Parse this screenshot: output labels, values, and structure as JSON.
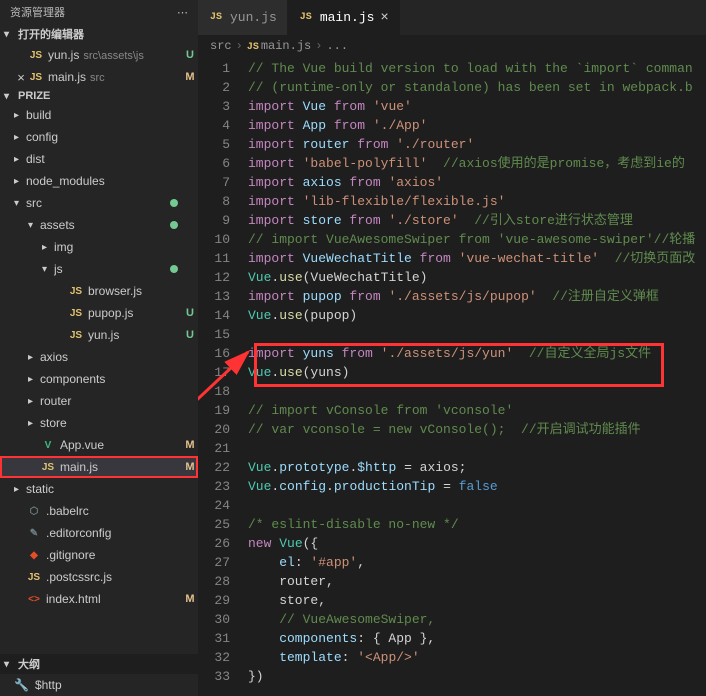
{
  "sidebar": {
    "title": "资源管理器",
    "open_editors_label": "打开的编辑器",
    "project_label": "PRIZE",
    "outline_label": "大纲",
    "open_editors": [
      {
        "icon": "JS",
        "name": "yun.js",
        "path": "src\\assets\\js",
        "status": "U"
      },
      {
        "icon": "JS",
        "name": "main.js",
        "path": "src",
        "status": "M",
        "close": true
      }
    ],
    "tree": [
      {
        "type": "folder",
        "name": "build",
        "indent": 0,
        "expanded": false
      },
      {
        "type": "folder",
        "name": "config",
        "indent": 0,
        "expanded": false
      },
      {
        "type": "folder",
        "name": "dist",
        "indent": 0,
        "expanded": false
      },
      {
        "type": "folder",
        "name": "node_modules",
        "indent": 0,
        "expanded": false
      },
      {
        "type": "folder",
        "name": "src",
        "indent": 0,
        "expanded": true,
        "dot": true
      },
      {
        "type": "folder",
        "name": "assets",
        "indent": 1,
        "expanded": true,
        "dot": true
      },
      {
        "type": "folder",
        "name": "img",
        "indent": 2,
        "expanded": false
      },
      {
        "type": "folder",
        "name": "js",
        "indent": 2,
        "expanded": true,
        "dot": true
      },
      {
        "type": "file",
        "icon": "JS",
        "name": "browser.js",
        "indent": 3
      },
      {
        "type": "file",
        "icon": "JS",
        "name": "pupop.js",
        "indent": 3,
        "status": "U"
      },
      {
        "type": "file",
        "icon": "JS",
        "name": "yun.js",
        "indent": 3,
        "status": "U"
      },
      {
        "type": "folder",
        "name": "axios",
        "indent": 1,
        "expanded": false
      },
      {
        "type": "folder",
        "name": "components",
        "indent": 1,
        "expanded": false
      },
      {
        "type": "folder",
        "name": "router",
        "indent": 1,
        "expanded": false
      },
      {
        "type": "folder",
        "name": "store",
        "indent": 1,
        "expanded": false
      },
      {
        "type": "file",
        "icon": "V",
        "iconClass": "icon-vue",
        "name": "App.vue",
        "indent": 1,
        "status": "M"
      },
      {
        "type": "file",
        "icon": "JS",
        "name": "main.js",
        "indent": 1,
        "status": "M",
        "highlighted": true,
        "selected": true
      },
      {
        "type": "folder",
        "name": "static",
        "indent": 0,
        "expanded": false
      },
      {
        "type": "file",
        "icon": "⬡",
        "iconClass": "icon-conf",
        "name": ".babelrc",
        "indent": 0
      },
      {
        "type": "file",
        "icon": "✎",
        "iconClass": "icon-conf",
        "name": ".editorconfig",
        "indent": 0
      },
      {
        "type": "file",
        "icon": "◆",
        "iconClass": "icon-git",
        "name": ".gitignore",
        "indent": 0
      },
      {
        "type": "file",
        "icon": "JS",
        "name": ".postcssrc.js",
        "indent": 0
      },
      {
        "type": "file",
        "icon": "<>",
        "iconClass": "icon-html",
        "name": "index.html",
        "indent": 0,
        "status": "M"
      }
    ],
    "outline_item": "$http"
  },
  "tabs": [
    {
      "icon": "JS",
      "name": "yun.js",
      "active": false
    },
    {
      "icon": "JS",
      "name": "main.js",
      "active": true
    }
  ],
  "breadcrumb": [
    "src",
    "main.js",
    "..."
  ],
  "code": {
    "lines": [
      [
        {
          "t": "// The Vue build version to load with the `import` comman",
          "c": "c-comment"
        }
      ],
      [
        {
          "t": "// (runtime-only or standalone) has been set in webpack.b",
          "c": "c-comment"
        }
      ],
      [
        {
          "t": "import",
          "c": "c-keyword"
        },
        {
          "t": " Vue ",
          "c": "c-var"
        },
        {
          "t": "from",
          "c": "c-keyword"
        },
        {
          "t": " 'vue'",
          "c": "c-string"
        }
      ],
      [
        {
          "t": "import",
          "c": "c-keyword"
        },
        {
          "t": " App ",
          "c": "c-var"
        },
        {
          "t": "from",
          "c": "c-keyword"
        },
        {
          "t": " './App'",
          "c": "c-string"
        }
      ],
      [
        {
          "t": "import",
          "c": "c-keyword"
        },
        {
          "t": " router ",
          "c": "c-var"
        },
        {
          "t": "from",
          "c": "c-keyword"
        },
        {
          "t": " './router'",
          "c": "c-string"
        }
      ],
      [
        {
          "t": "import",
          "c": "c-keyword"
        },
        {
          "t": " 'babel-polyfill'",
          "c": "c-string"
        },
        {
          "t": "  //axios使用的是promise，考虑到ie的",
          "c": "c-comment"
        }
      ],
      [
        {
          "t": "import",
          "c": "c-keyword"
        },
        {
          "t": " axios ",
          "c": "c-var"
        },
        {
          "t": "from",
          "c": "c-keyword"
        },
        {
          "t": " 'axios'",
          "c": "c-string"
        }
      ],
      [
        {
          "t": "import",
          "c": "c-keyword"
        },
        {
          "t": " 'lib-flexible/flexible.js'",
          "c": "c-string"
        }
      ],
      [
        {
          "t": "import",
          "c": "c-keyword"
        },
        {
          "t": " store ",
          "c": "c-var"
        },
        {
          "t": "from",
          "c": "c-keyword"
        },
        {
          "t": " './store'",
          "c": "c-string"
        },
        {
          "t": "  //引入store进行状态管理",
          "c": "c-comment"
        }
      ],
      [
        {
          "t": "// import VueAwesomeSwiper from 'vue-awesome-swiper'//轮播",
          "c": "c-comment"
        }
      ],
      [
        {
          "t": "import",
          "c": "c-keyword"
        },
        {
          "t": " VueWechatTitle ",
          "c": "c-var"
        },
        {
          "t": "from",
          "c": "c-keyword"
        },
        {
          "t": " 'vue-wechat-title'",
          "c": "c-string"
        },
        {
          "t": "  //切换页面改",
          "c": "c-comment"
        }
      ],
      [
        {
          "t": "Vue",
          "c": "c-type"
        },
        {
          "t": ".",
          "c": "c-punct"
        },
        {
          "t": "use",
          "c": "c-func"
        },
        {
          "t": "(VueWechatTitle)",
          "c": "c-punct"
        }
      ],
      [
        {
          "t": "import",
          "c": "c-keyword"
        },
        {
          "t": " pupop ",
          "c": "c-var"
        },
        {
          "t": "from",
          "c": "c-keyword"
        },
        {
          "t": " './assets/js/pupop'",
          "c": "c-string"
        },
        {
          "t": "  //注册自定义弹框",
          "c": "c-comment"
        }
      ],
      [
        {
          "t": "Vue",
          "c": "c-type"
        },
        {
          "t": ".",
          "c": "c-punct"
        },
        {
          "t": "use",
          "c": "c-func"
        },
        {
          "t": "(pupop)",
          "c": "c-punct"
        }
      ],
      [],
      [
        {
          "t": "import",
          "c": "c-keyword"
        },
        {
          "t": " yuns ",
          "c": "c-var"
        },
        {
          "t": "from",
          "c": "c-keyword"
        },
        {
          "t": " './assets/js/yun'",
          "c": "c-string"
        },
        {
          "t": "  //自定义全局js文件",
          "c": "c-comment"
        }
      ],
      [
        {
          "t": "Vue",
          "c": "c-type"
        },
        {
          "t": ".",
          "c": "c-punct"
        },
        {
          "t": "use",
          "c": "c-func"
        },
        {
          "t": "(yuns)",
          "c": "c-punct"
        }
      ],
      [],
      [
        {
          "t": "// import vConsole from 'vconsole'",
          "c": "c-comment"
        }
      ],
      [
        {
          "t": "// var vconsole = new vConsole();  //开启调试功能插件",
          "c": "c-comment"
        }
      ],
      [],
      [
        {
          "t": "Vue",
          "c": "c-type"
        },
        {
          "t": ".",
          "c": "c-punct"
        },
        {
          "t": "prototype",
          "c": "c-var"
        },
        {
          "t": ".",
          "c": "c-punct"
        },
        {
          "t": "$http",
          "c": "c-prop"
        },
        {
          "t": " = axios;",
          "c": "c-punct"
        }
      ],
      [
        {
          "t": "Vue",
          "c": "c-type"
        },
        {
          "t": ".",
          "c": "c-punct"
        },
        {
          "t": "config",
          "c": "c-var"
        },
        {
          "t": ".",
          "c": "c-punct"
        },
        {
          "t": "productionTip",
          "c": "c-prop"
        },
        {
          "t": " = ",
          "c": "c-punct"
        },
        {
          "t": "false",
          "c": "c-bool"
        }
      ],
      [],
      [
        {
          "t": "/* eslint-disable no-new */",
          "c": "c-comment"
        }
      ],
      [
        {
          "t": "new",
          "c": "c-keyword"
        },
        {
          "t": " ",
          "c": "c-punct"
        },
        {
          "t": "Vue",
          "c": "c-type"
        },
        {
          "t": "({",
          "c": "c-punct"
        }
      ],
      [
        {
          "t": "    el",
          "c": "c-prop"
        },
        {
          "t": ": ",
          "c": "c-punct"
        },
        {
          "t": "'#app'",
          "c": "c-string"
        },
        {
          "t": ",",
          "c": "c-punct"
        }
      ],
      [
        {
          "t": "    router,",
          "c": "c-punct"
        }
      ],
      [
        {
          "t": "    store,",
          "c": "c-punct"
        }
      ],
      [
        {
          "t": "    // VueAwesomeSwiper,",
          "c": "c-comment"
        }
      ],
      [
        {
          "t": "    components",
          "c": "c-prop"
        },
        {
          "t": ": { App },",
          "c": "c-punct"
        }
      ],
      [
        {
          "t": "    template",
          "c": "c-prop"
        },
        {
          "t": ": ",
          "c": "c-punct"
        },
        {
          "t": "'<App/>'",
          "c": "c-string"
        }
      ],
      [
        {
          "t": "})",
          "c": "c-punct"
        }
      ]
    ]
  }
}
